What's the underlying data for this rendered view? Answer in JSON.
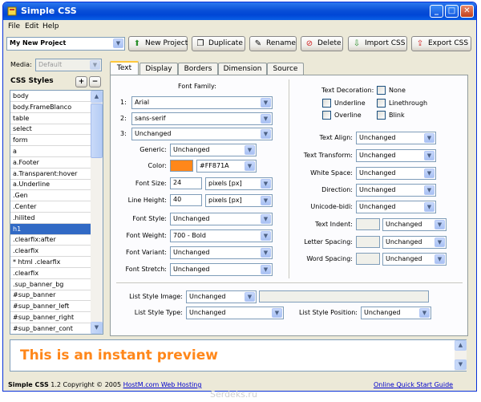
{
  "window": {
    "title": "Simple CSS",
    "buttons": {
      "minimize": "_",
      "maximize": "□",
      "close": "✕"
    }
  },
  "menu": [
    "File",
    "Edit",
    "Help"
  ],
  "toolbar": {
    "project": "My New Project",
    "new_project": "New Project",
    "duplicate": "Duplicate",
    "rename": "Rename",
    "delete": "Delete",
    "import_css": "Import CSS",
    "export_css": "Export CSS"
  },
  "sidebar": {
    "media_label": "Media:",
    "media_value": "Default",
    "styles_title": "CSS Styles",
    "add": "+",
    "remove": "−",
    "items": [
      "body",
      "body.FrameBlanco",
      "table",
      "select",
      "form",
      "a",
      "a.Footer",
      "a.Transparent:hover",
      "a.Underline",
      ".Gen",
      ".Center",
      ".hilited",
      "h1",
      ".clearfix:after",
      ".clearfix",
      "* html .clearfix",
      ".clearfix",
      ".sup_banner_bg",
      "#sup_banner",
      "#sup_banner_left",
      "#sup_banner_right",
      "#sup_banner_cont"
    ],
    "selected_index": 12
  },
  "tabs": [
    "Text",
    "Display",
    "Borders",
    "Dimension",
    "Source"
  ],
  "active_tab": "Text",
  "text_tab": {
    "font_family_label": "Font Family:",
    "font_rows": [
      {
        "num": "1:",
        "value": "Arial"
      },
      {
        "num": "2:",
        "value": "sans-serif"
      },
      {
        "num": "3:",
        "value": "Unchanged"
      }
    ],
    "generic": {
      "label": "Generic:",
      "value": "Unchanged"
    },
    "color": {
      "label": "Color:",
      "value": "#FF871A",
      "swatch": "#ff871a"
    },
    "font_size": {
      "label": "Font Size:",
      "value": "24",
      "unit": "pixels [px]"
    },
    "line_height": {
      "label": "Line Height:",
      "value": "40",
      "unit": "pixels [px]"
    },
    "font_style": {
      "label": "Font Style:",
      "value": "Unchanged"
    },
    "font_weight": {
      "label": "Font Weight:",
      "value": "700 - Bold"
    },
    "font_variant": {
      "label": "Font Variant:",
      "value": "Unchanged"
    },
    "font_stretch": {
      "label": "Font Stretch:",
      "value": "Unchanged"
    },
    "text_decoration": {
      "label": "Text Decoration:",
      "options": [
        "None",
        "Underline",
        "Linethrough",
        "Overline",
        "Blink"
      ]
    },
    "text_align": {
      "label": "Text Align:",
      "value": "Unchanged"
    },
    "text_transform": {
      "label": "Text Transform:",
      "value": "Unchanged"
    },
    "white_space": {
      "label": "White Space:",
      "value": "Unchanged"
    },
    "direction": {
      "label": "Direction:",
      "value": "Unchanged"
    },
    "unicode_bidi": {
      "label": "Unicode-bidi:",
      "value": "Unchanged"
    },
    "text_indent": {
      "label": "Text Indent:",
      "value": "Unchanged"
    },
    "letter_spacing": {
      "label": "Letter Spacing:",
      "value": "Unchanged"
    },
    "word_spacing": {
      "label": "Word Spacing:",
      "value": "Unchanged"
    },
    "list_style_image": {
      "label": "List Style Image:",
      "value": "Unchanged"
    },
    "list_style_type": {
      "label": "List Style Type:",
      "value": "Unchanged"
    },
    "list_style_position": {
      "label": "List Style Position:",
      "value": "Unchanged"
    }
  },
  "preview": {
    "text": "This is an instant preview",
    "color": "#ff871a"
  },
  "status": {
    "app": "Simple CSS",
    "version": " 1.2 Copyright © 2005 ",
    "link": "HostM.com Web Hosting",
    "guide": "Online Quick Start Guide"
  },
  "watermark": "Serdeks.ru"
}
